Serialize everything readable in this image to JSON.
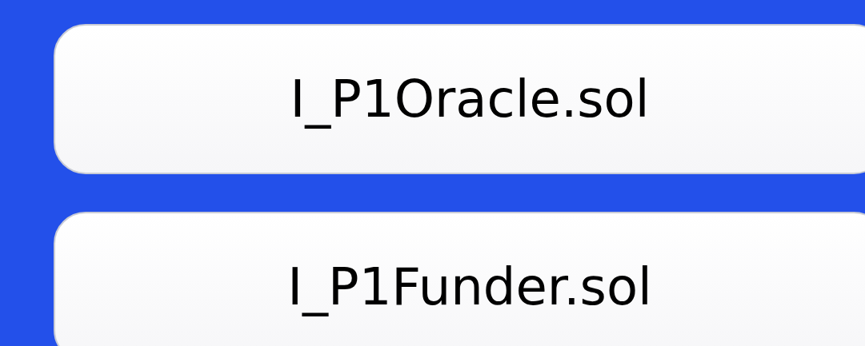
{
  "files": [
    {
      "name": "I_P1Oracle.sol"
    },
    {
      "name": "I_P1Funder.sol"
    }
  ]
}
